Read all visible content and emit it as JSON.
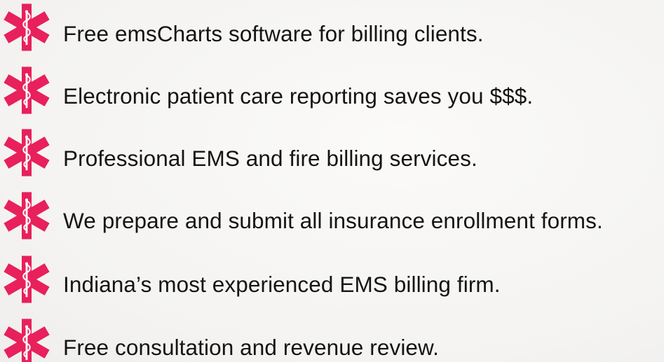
{
  "icon": {
    "name": "star-of-life-icon",
    "color": "#e8205c"
  },
  "items": [
    {
      "text": "Free emsCharts software for billing clients."
    },
    {
      "text": "Electronic patient care reporting saves you $$$."
    },
    {
      "text": "Professional EMS and fire billing services."
    },
    {
      "text": "We prepare and submit all insurance enrollment forms."
    },
    {
      "text": "Indiana’s most experienced EMS billing firm."
    },
    {
      "text": "Free consultation and revenue review."
    }
  ]
}
